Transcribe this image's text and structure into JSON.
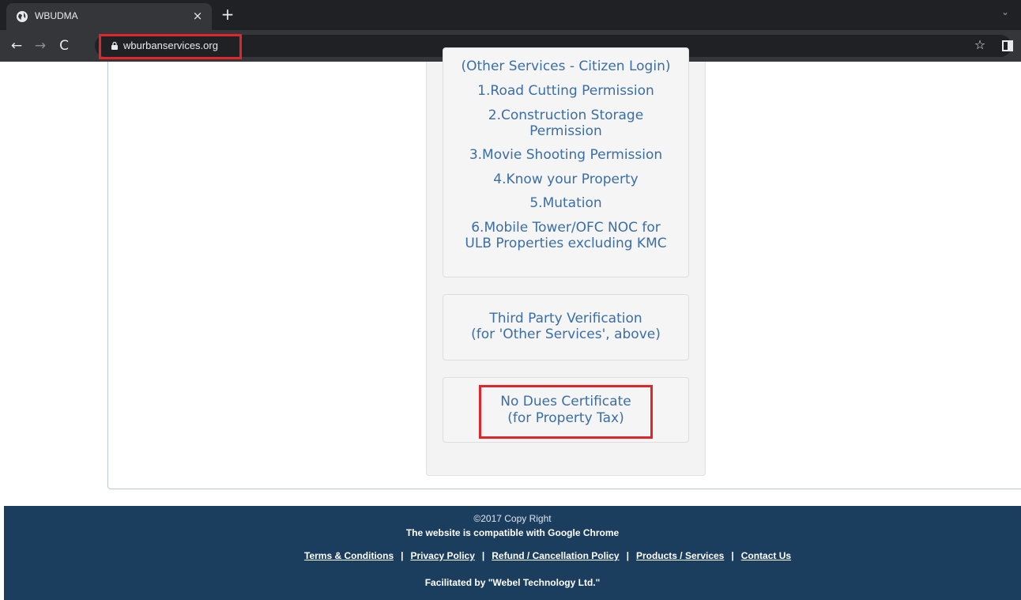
{
  "browser": {
    "tab_title": "WBUDMA",
    "tab_close": "×",
    "new_tab": "+",
    "tab_list": "⌄",
    "back": "←",
    "forward": "→",
    "reload": "C",
    "url": "wburbanservices.org",
    "bookmark": "☆"
  },
  "services": {
    "header": "(Other Services - Citizen Login)",
    "items": [
      "1.Road Cutting Permission",
      "2.Construction Storage Permission",
      "3.Movie Shooting Permission",
      "4.Know your Property",
      "5.Mutation",
      "6.Mobile Tower/OFC NOC for ULB Properties excluding KMC"
    ]
  },
  "third_party": {
    "line1": "Third Party Verification",
    "line2": "(for 'Other Services', above)"
  },
  "no_dues": {
    "line1": "No Dues Certificate",
    "line2": "(for Property Tax)"
  },
  "footer": {
    "copyright": "©2017 Copy Right",
    "compat": "The website is compatible with Google Chrome",
    "links": [
      "Terms & Conditions",
      "Privacy Policy",
      "Refund / Cancellation Policy",
      "Products / Services",
      "Contact Us"
    ],
    "separator": "|",
    "facilitated": "Facilitated by \"Webel Technology Ltd.\""
  },
  "colors": {
    "link": "#3a6ea5",
    "footer_bg": "#1b3e5f",
    "highlight": "#e0262b"
  }
}
